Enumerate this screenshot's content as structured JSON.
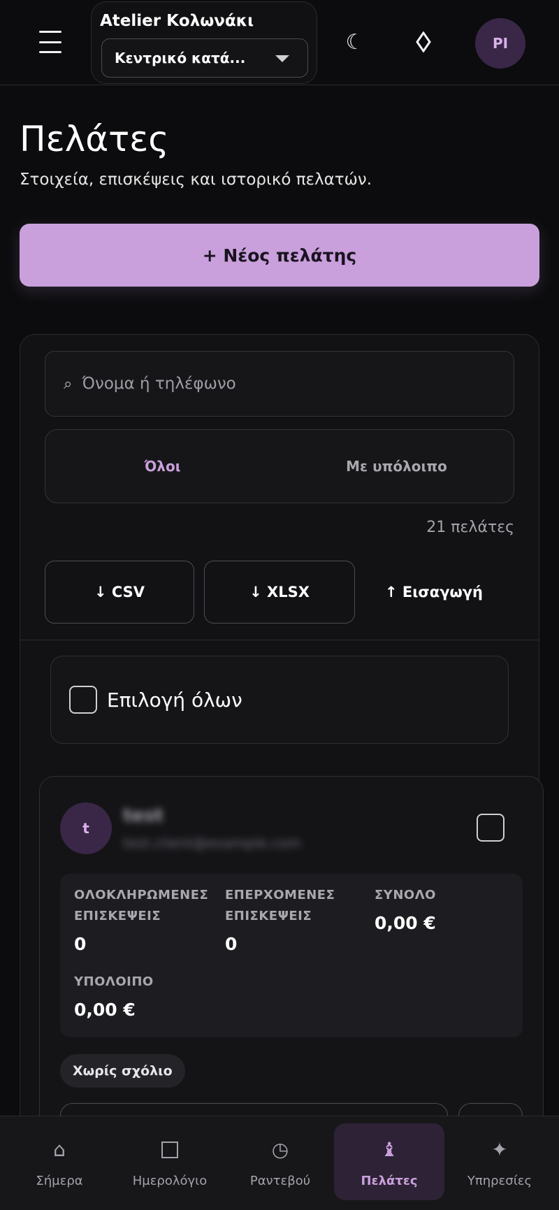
{
  "header": {
    "business_name": "Atelier Κολωνάκι",
    "branch_selected": "Κεντρικό κατά...",
    "theme_icon": "moon-icon",
    "gem_icon": "diamond-icon",
    "user_initials": "PI"
  },
  "page": {
    "title": "Πελάτες",
    "subtitle": "Στοιχεία, επισκέψεις και ιστορικό πελατών.",
    "new_client_label": "+ Νέος πελάτης"
  },
  "filters": {
    "search_placeholder": "Όνομα ή τηλέφωνο",
    "tabs": [
      "Όλοι",
      "Με υπόλοιπο"
    ],
    "active_tab": "Όλοι",
    "count_text": "21 πελάτες",
    "export_csv": "↓ CSV",
    "export_xlsx": "↓ XLSX",
    "import_label": "↑ Εισαγωγή",
    "select_all_label": "Επιλογή όλων"
  },
  "client": {
    "avatar_letter": "t",
    "name": "test",
    "email": "test.client@example.com",
    "stats": {
      "completed_label_1": "ΟΛΟΚΛΗΡΩΜΕΝΕΣ",
      "completed_label_2": "ΕΠΙΣΚΕΨΕΙΣ",
      "completed_value": "0",
      "upcoming_label_1": "ΕΠΕΡΧΟΜΕΝΕΣ",
      "upcoming_label_2": "ΕΠΙΣΚΕΨΕΙΣ",
      "upcoming_value": "0",
      "total_label": "ΣΥΝΟΛΟ",
      "total_value": "0,00 €",
      "balance_label": "ΥΠΟΛΟΙΠΟ",
      "balance_value": "0,00 €"
    },
    "note_chip": "Χωρίς σχόλιο"
  },
  "bottom_nav": {
    "items": [
      {
        "label": "Σήμερα",
        "icon": "home-icon"
      },
      {
        "label": "Ημερολόγιο",
        "icon": "calendar-icon"
      },
      {
        "label": "Ραντεβού",
        "icon": "clock-icon"
      },
      {
        "label": "Πελάτες",
        "icon": "person-icon"
      },
      {
        "label": "Υπηρεσίες",
        "icon": "sparkle-icon"
      }
    ],
    "active": "Πελάτες"
  },
  "colors": {
    "accent": "#c9a0dc",
    "background": "#0c0c0e",
    "avatar_bg": "#3a2748"
  }
}
